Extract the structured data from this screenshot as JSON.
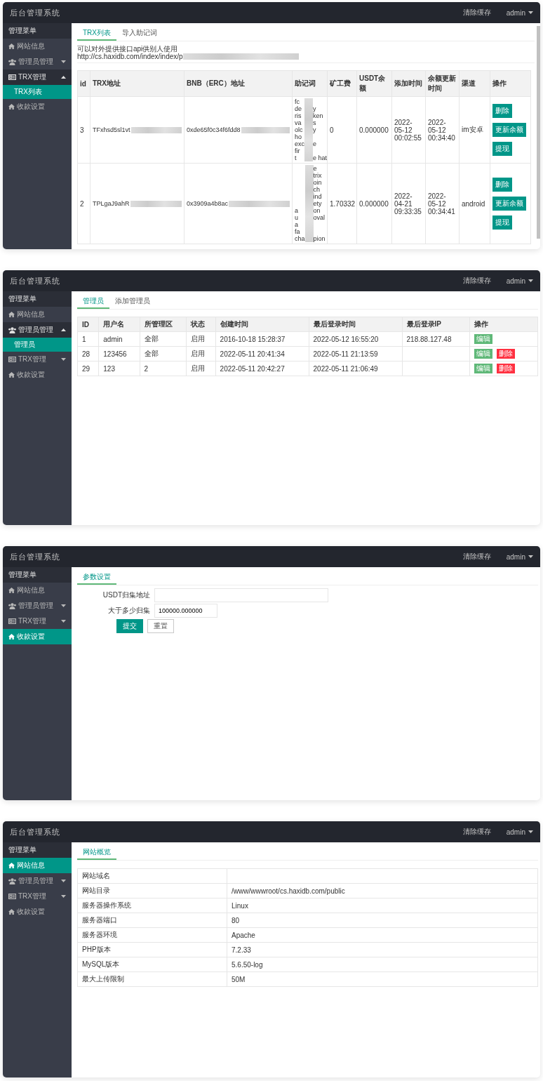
{
  "panels": [
    {
      "header": {
        "title": "后台管理系统",
        "clear_cache": "清除缓存",
        "user": "admin"
      },
      "sidebar": {
        "heading": "管理菜单",
        "items": [
          {
            "label": "网站信息",
            "kind": "home",
            "selected": false
          },
          {
            "label": "管理员管理",
            "kind": "users",
            "selected": false,
            "expanded": false
          },
          {
            "label": "TRX管理",
            "kind": "card",
            "selected": false,
            "expanded": true,
            "children": [
              {
                "label": "TRX列表",
                "selected": true
              }
            ]
          },
          {
            "label": "收款设置",
            "kind": "home",
            "selected": false
          }
        ]
      },
      "tabs": [
        {
          "label": "TRX列表",
          "selected": true
        },
        {
          "label": "导入助记词",
          "selected": false
        }
      ],
      "content": {
        "kind": "trx_list",
        "note": "可以对外提供接口api供别人使用",
        "url": "http://cs.haxidb.com/index/index/p",
        "columns": [
          "id",
          "TRX地址",
          "BNB（ERC）地址",
          "助记词",
          "矿工费",
          "USDT余额",
          "添加时间",
          "余额更新时间",
          "渠道",
          "操作"
        ],
        "rows": [
          {
            "id": "3",
            "trx": "TFxhsd5sl1vt",
            "bnb": "0xde65f0c34f6fdd8",
            "mnemonic": [
              {
                "left": "fc"
              },
              {
                "left": "de",
                "right": "y"
              },
              {
                "left": "ris",
                "right": "ken"
              },
              {
                "left": "va",
                "right": "s"
              },
              {
                "left": "olc",
                "right": "y"
              },
              {
                "left": "ho"
              },
              {
                "left": "exc",
                "right": "e"
              },
              {
                "left": "fir"
              },
              {
                "left": "t",
                "right": "e hat"
              }
            ],
            "fee": "0",
            "usdt": "0.000000",
            "added": "2022-05-12 00:02:55",
            "updated": "2022-05-12 00:34:40",
            "channel": "im安卓",
            "actions": [
              "删除",
              "更新余额",
              "提现"
            ]
          },
          {
            "id": "2",
            "trx": "TPLgaJ9ahR",
            "bnb": "0x3909a4b8ac",
            "mnemonic": [
              {
                "right": "e"
              },
              {
                "right": "trix"
              },
              {
                "right": "oin"
              },
              {
                "right": "ch"
              },
              {
                "right": "ind"
              },
              {
                "right": "ety"
              },
              {
                "left": "a",
                "right": "on"
              },
              {
                "left": "u",
                "right": "oval"
              },
              {
                "left": "a"
              },
              {
                "left": "fa"
              },
              {
                "left": "cha",
                "right": "pion"
              }
            ],
            "fee": "1.70332",
            "usdt": "0.000000",
            "added": "2022-04-21 09:33:35",
            "updated": "2022-05-12 00:34:41",
            "channel": "android",
            "actions": [
              "删除",
              "更新余额",
              "提现"
            ]
          }
        ]
      }
    },
    {
      "header": {
        "title": "后台管理系统",
        "clear_cache": "清除缓存",
        "user": "admin"
      },
      "sidebar": {
        "heading": "管理菜单",
        "items": [
          {
            "label": "网站信息",
            "kind": "home",
            "selected": false
          },
          {
            "label": "管理员管理",
            "kind": "users",
            "selected": false,
            "expanded": true,
            "children": [
              {
                "label": "管理员",
                "selected": true
              }
            ]
          },
          {
            "label": "TRX管理",
            "kind": "card",
            "selected": false,
            "expanded": false
          },
          {
            "label": "收款设置",
            "kind": "home",
            "selected": false
          }
        ]
      },
      "tabs": [
        {
          "label": "管理员",
          "selected": true
        },
        {
          "label": "添加管理员",
          "selected": false
        }
      ],
      "content": {
        "kind": "admin_list",
        "columns": [
          "ID",
          "用户名",
          "所管理区",
          "状态",
          "创建时间",
          "最后登录时间",
          "最后登录IP",
          "操作"
        ],
        "rows": [
          {
            "cells": [
              "1",
              "admin",
              "全部",
              "启用",
              "2016-10-18 15:28:37",
              "2022-05-12 16:55:20",
              "218.88.127.48"
            ],
            "actions": [
              {
                "label": "编辑",
                "kind": "edit"
              }
            ]
          },
          {
            "cells": [
              "28",
              "123456",
              "全部",
              "启用",
              "2022-05-11 20:41:34",
              "2022-05-11 21:13:59",
              null
            ],
            "actions": [
              {
                "label": "编辑",
                "kind": "edit"
              },
              {
                "label": "删除",
                "kind": "delete"
              }
            ]
          },
          {
            "cells": [
              "29",
              "123",
              "2",
              "启用",
              "2022-05-11 20:42:27",
              "2022-05-11 21:06:49",
              null
            ],
            "actions": [
              {
                "label": "编辑",
                "kind": "edit"
              },
              {
                "label": "删除",
                "kind": "delete"
              }
            ]
          }
        ]
      }
    },
    {
      "header": {
        "title": "后台管理系统",
        "clear_cache": "清除缓存",
        "user": "admin"
      },
      "sidebar": {
        "heading": "管理菜单",
        "items": [
          {
            "label": "网站信息",
            "kind": "home",
            "selected": false
          },
          {
            "label": "管理员管理",
            "kind": "users",
            "selected": false,
            "expanded": false
          },
          {
            "label": "TRX管理",
            "kind": "card",
            "selected": false,
            "expanded": false
          },
          {
            "label": "收款设置",
            "kind": "home",
            "selected": true
          }
        ]
      },
      "tabs": [
        {
          "label": "参数设置",
          "selected": true
        }
      ],
      "content": {
        "kind": "settings_form",
        "fields": [
          {
            "label": "USDT归集地址"
          },
          {
            "label": "大于多少归集",
            "value": "100000.000000"
          }
        ],
        "buttons": [
          {
            "label": "提交",
            "kind": "primary"
          },
          {
            "label": "重置",
            "kind": "secondary"
          }
        ]
      }
    },
    {
      "header": {
        "title": "后台管理系统",
        "clear_cache": "清除缓存",
        "user": "admin"
      },
      "sidebar": {
        "heading": "管理菜单",
        "items": [
          {
            "label": "网站信息",
            "kind": "home",
            "selected": true
          },
          {
            "label": "管理员管理",
            "kind": "users",
            "selected": false,
            "expanded": false
          },
          {
            "label": "TRX管理",
            "kind": "card",
            "selected": false,
            "expanded": false
          },
          {
            "label": "收款设置",
            "kind": "home",
            "selected": false
          }
        ]
      },
      "tabs": [
        {
          "label": "网站概览",
          "selected": true
        }
      ],
      "content": {
        "kind": "info_table",
        "rows": [
          {
            "label": "网站域名"
          },
          {
            "label": "网站目录",
            "value": "/www/wwwroot/cs.haxidb.com/public"
          },
          {
            "label": "服务器操作系统",
            "value": "Linux"
          },
          {
            "label": "服务器端口",
            "value": "80"
          },
          {
            "label": "服务器环境",
            "value": "Apache"
          },
          {
            "label": "PHP版本",
            "value": "7.2.33"
          },
          {
            "label": "MySQL版本",
            "value": "5.6.50-log"
          },
          {
            "label": "最大上传限制",
            "value": "50M"
          }
        ]
      }
    }
  ]
}
